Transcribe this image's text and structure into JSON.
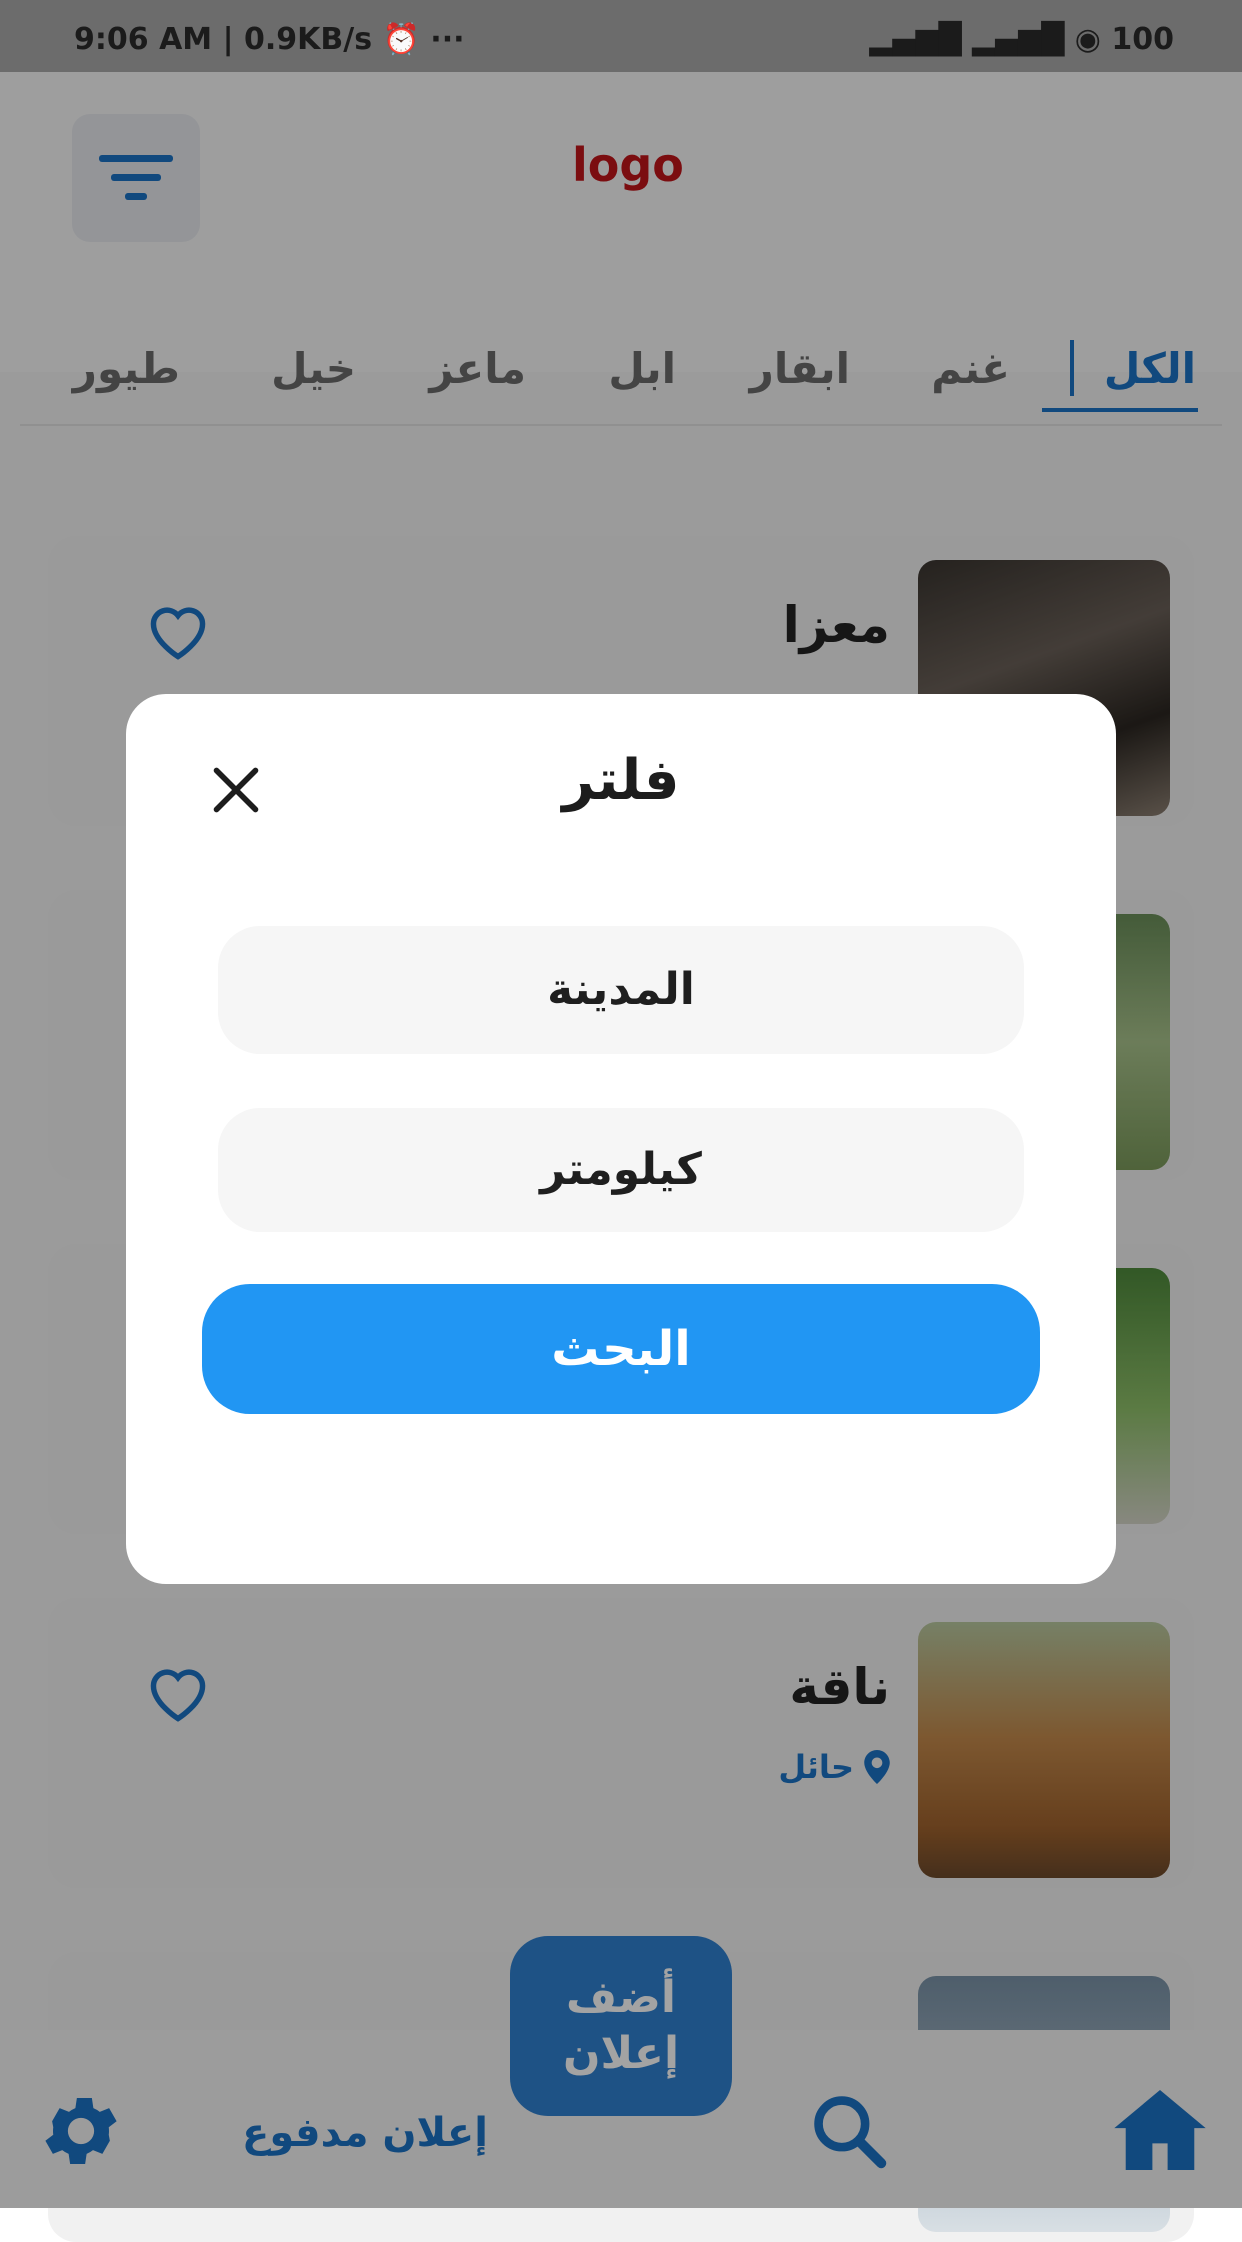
{
  "status_bar": {
    "time_speed": "9:06 AM | 0.9KB/s ⏰ ···",
    "icons": "▂▄▆█ ▂▄▆█ ◉ 100"
  },
  "header": {
    "logo": "logo",
    "filter_icon": "filter-icon"
  },
  "tabs": [
    {
      "label": "الكل",
      "active": true
    },
    {
      "label": "غنم"
    },
    {
      "label": "ابقار"
    },
    {
      "label": "ابل"
    },
    {
      "label": "ماعز"
    },
    {
      "label": "خيل"
    },
    {
      "label": "طيور"
    }
  ],
  "listings": [
    {
      "title": "معزا",
      "location": ""
    },
    {
      "title": "",
      "location": ""
    },
    {
      "title": "",
      "location": ""
    },
    {
      "title": "ناقة",
      "location": "حائل"
    },
    {
      "title": "...",
      "location": ""
    }
  ],
  "filter_modal": {
    "title": "فلتر",
    "city_field": "المدينة",
    "km_field": "كيلومتر",
    "search_button": "البحث"
  },
  "bottom_nav": {
    "paid_ad": "إعلان مدفوع",
    "add_ad_line1": "أضف",
    "add_ad_line2": "إعلان"
  },
  "colors": {
    "accent": "#2196f3",
    "brand_blue": "#1b73c5",
    "logo_red": "#c0151a"
  }
}
